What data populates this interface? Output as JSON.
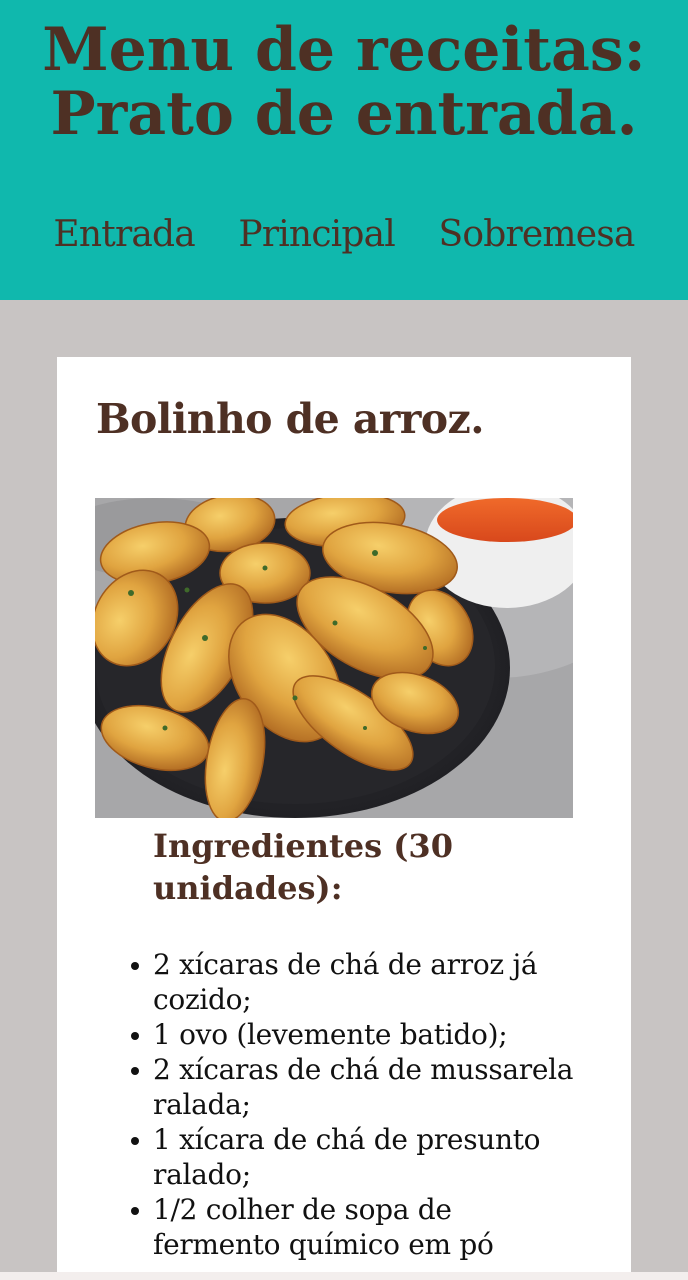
{
  "header": {
    "title": "Menu de receitas: Prato de entrada.",
    "title_line1": "Menu de receitas:",
    "title_line2": "Prato de entrada."
  },
  "nav": {
    "items": [
      {
        "label": "Entrada"
      },
      {
        "label": "Principal"
      },
      {
        "label": "Sobremesa"
      }
    ]
  },
  "recipe": {
    "title": "Bolinho de arroz.",
    "photo": "fried-rice-balls-photo",
    "ingredients_title_line1": "Ingredientes (30",
    "ingredients_title_line2": "unidades):",
    "ingredients": [
      {
        "line1": "2 xícaras de chá de arroz já",
        "line2": "cozido;"
      },
      {
        "line1": "1 ovo (levemente batido);",
        "line2": ""
      },
      {
        "line1": "2 xícaras de chá de mussarela",
        "line2": "ralada;"
      },
      {
        "line1": "1 xícara de chá de presunto",
        "line2": "ralado;"
      },
      {
        "line1": "1/2 colher de sopa de",
        "line2": "fermento químico em pó"
      }
    ]
  },
  "colors": {
    "header_bg": "#10b8ad",
    "title_color": "#4e3024",
    "page_bg": "#c8c4c3",
    "card_bg": "#ffffff"
  }
}
